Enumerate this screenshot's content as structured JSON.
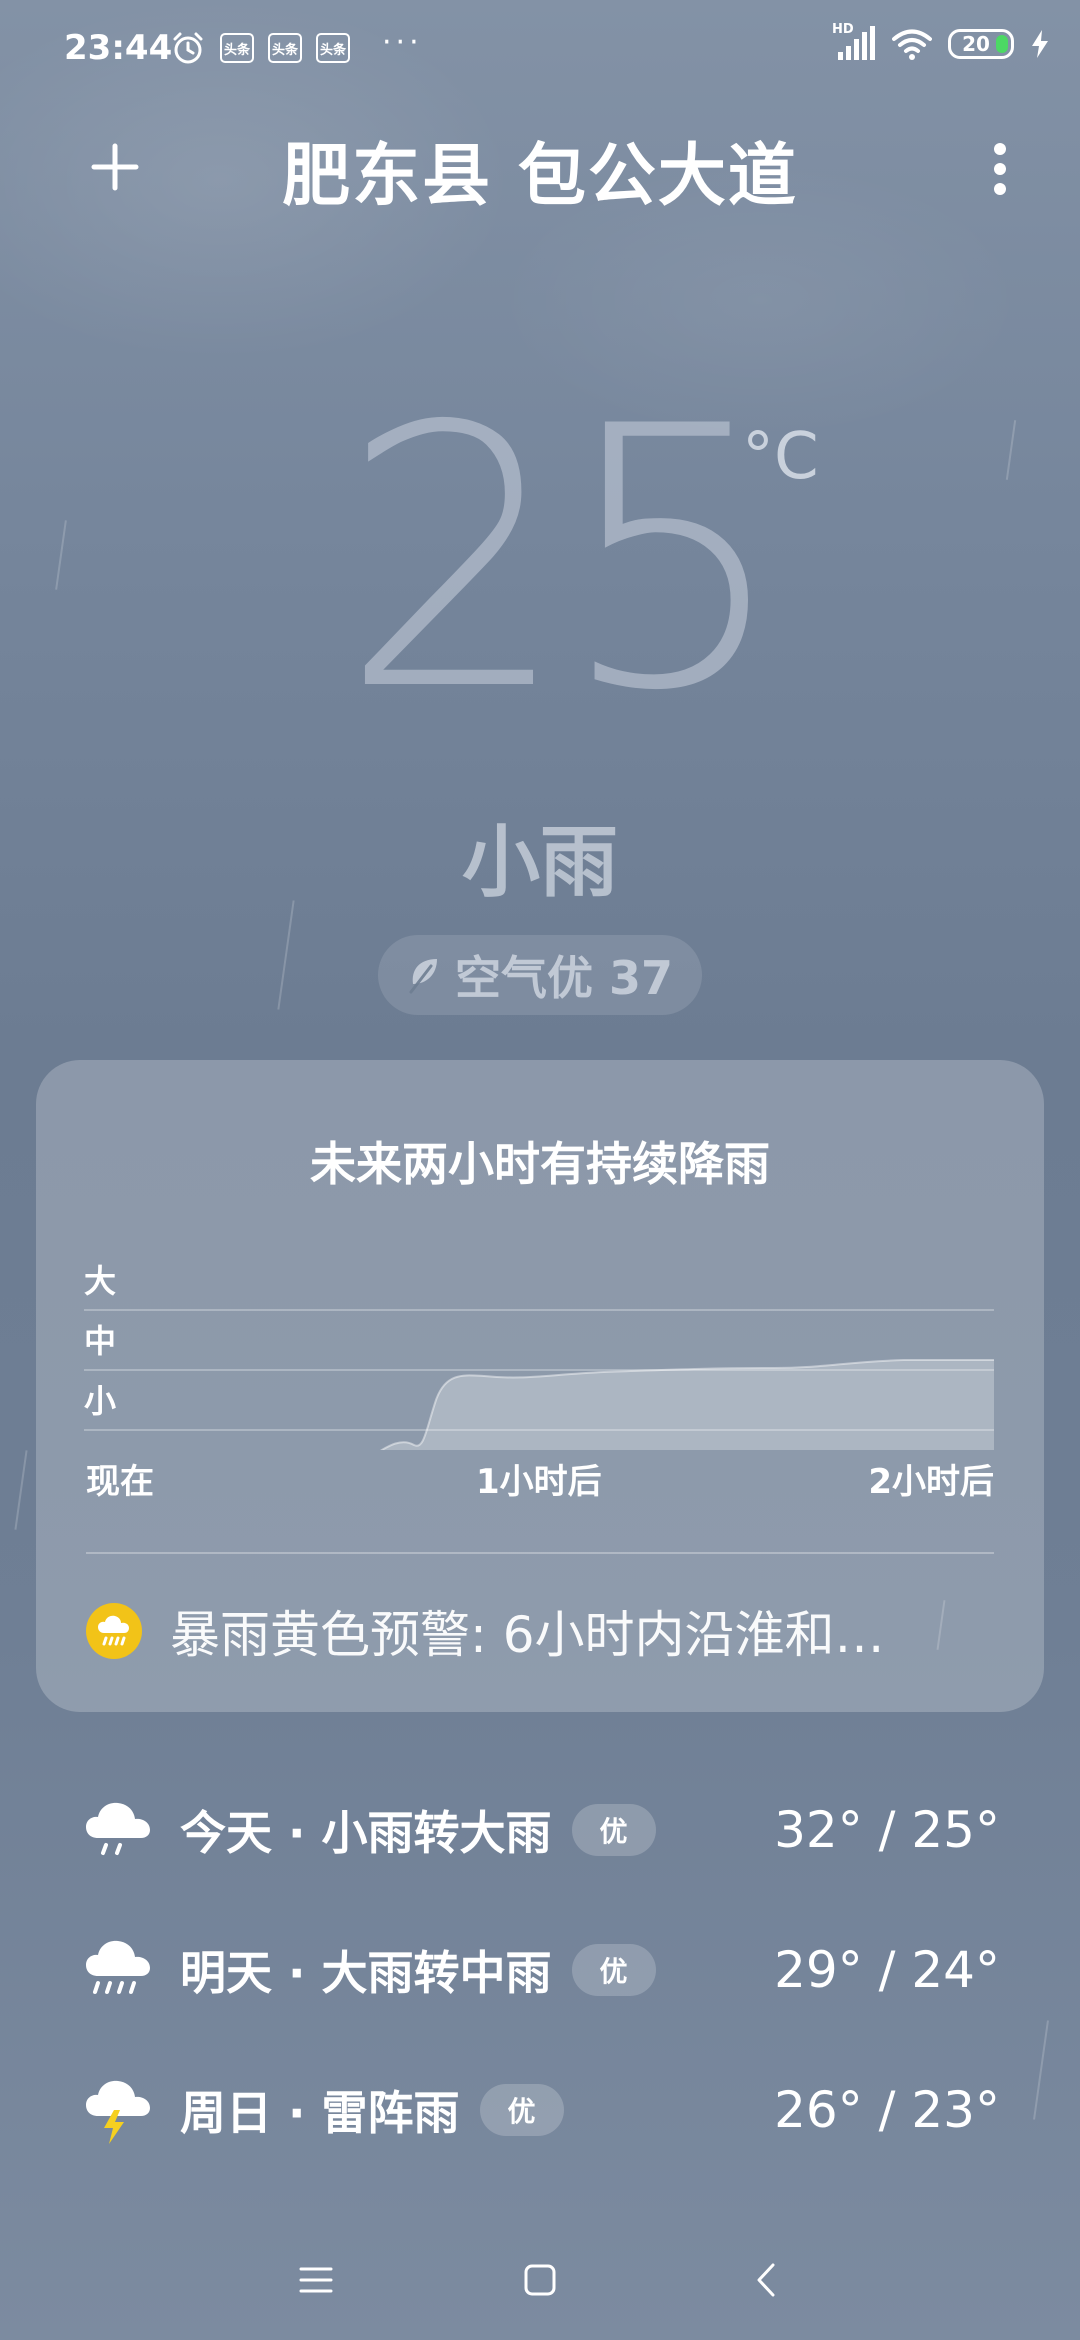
{
  "status_bar": {
    "time": "23:44",
    "news_badge": "头条",
    "overflow": "···",
    "network": "HD",
    "battery_level": "20"
  },
  "header": {
    "location": "肥东县 包公大道"
  },
  "current": {
    "temperature": "25",
    "unit": "°C",
    "condition": "小雨",
    "air_quality": "空气优 37"
  },
  "rain_card": {
    "title": "未来两小时有持续降雨",
    "y_labels": [
      "大",
      "中",
      "小"
    ],
    "x_labels": [
      "现在",
      "1小时后",
      "2小时后"
    ],
    "alert": "暴雨黄色预警: 6小时内沿淮和…"
  },
  "forecast": [
    {
      "label": "今天 · 小雨转大雨",
      "aqi": "优",
      "temps": "32° / 25°",
      "icon": "light-rain-icon"
    },
    {
      "label": "明天 · 大雨转中雨",
      "aqi": "优",
      "temps": "29° / 24°",
      "icon": "heavy-rain-icon"
    },
    {
      "label": "周日 · 雷阵雨",
      "aqi": "优",
      "temps": "26° / 23°",
      "icon": "thunderstorm-icon"
    }
  ],
  "colors": {
    "alert_yellow": "#f2c318",
    "battery_green": "#4cd964",
    "lightning_yellow": "#f5d020"
  }
}
